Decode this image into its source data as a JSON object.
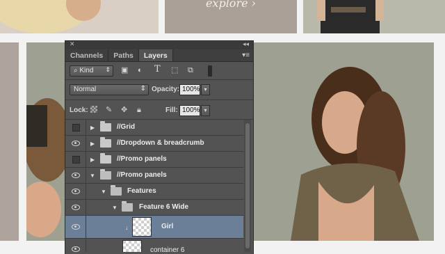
{
  "background": {
    "explore_label": "explore ›"
  },
  "panel": {
    "tabs": [
      {
        "label": "Channels",
        "active": false
      },
      {
        "label": "Paths",
        "active": false
      },
      {
        "label": "Layers",
        "active": true
      }
    ],
    "filter": {
      "kind_label": "Kind",
      "icons": [
        "pixel-filter-icon",
        "adjustment-filter-icon",
        "type-filter-icon",
        "shape-filter-icon",
        "smart-object-filter-icon",
        "filter-toggle-icon"
      ]
    },
    "blend_mode": "Normal",
    "opacity_label": "Opacity:",
    "opacity_value": "100%",
    "lock_label": "Lock:",
    "fill_label": "Fill:",
    "fill_value": "100%",
    "layers": [
      {
        "name": "//Grid",
        "visible": false,
        "type": "group",
        "expanded": false,
        "indent": 0
      },
      {
        "name": "//Dropdown & breadcrumb",
        "visible": true,
        "type": "group",
        "expanded": false,
        "indent": 0
      },
      {
        "name": "//Promo panels",
        "visible": false,
        "type": "group",
        "expanded": false,
        "indent": 0
      },
      {
        "name": "//Promo panels",
        "visible": true,
        "type": "group",
        "expanded": true,
        "indent": 0
      },
      {
        "name": "Features",
        "visible": true,
        "type": "group",
        "expanded": true,
        "indent": 1
      },
      {
        "name": "Feature 6 Wide",
        "visible": true,
        "type": "group",
        "expanded": true,
        "indent": 2
      },
      {
        "name": "Girl",
        "visible": true,
        "type": "smart-object",
        "selected": true,
        "indent": 3
      },
      {
        "name": "container 6",
        "visible": true,
        "type": "smart-object",
        "indent": 3
      }
    ]
  },
  "colors": {
    "panel_bg": "#535353",
    "selected_row": "#6b7f99"
  }
}
